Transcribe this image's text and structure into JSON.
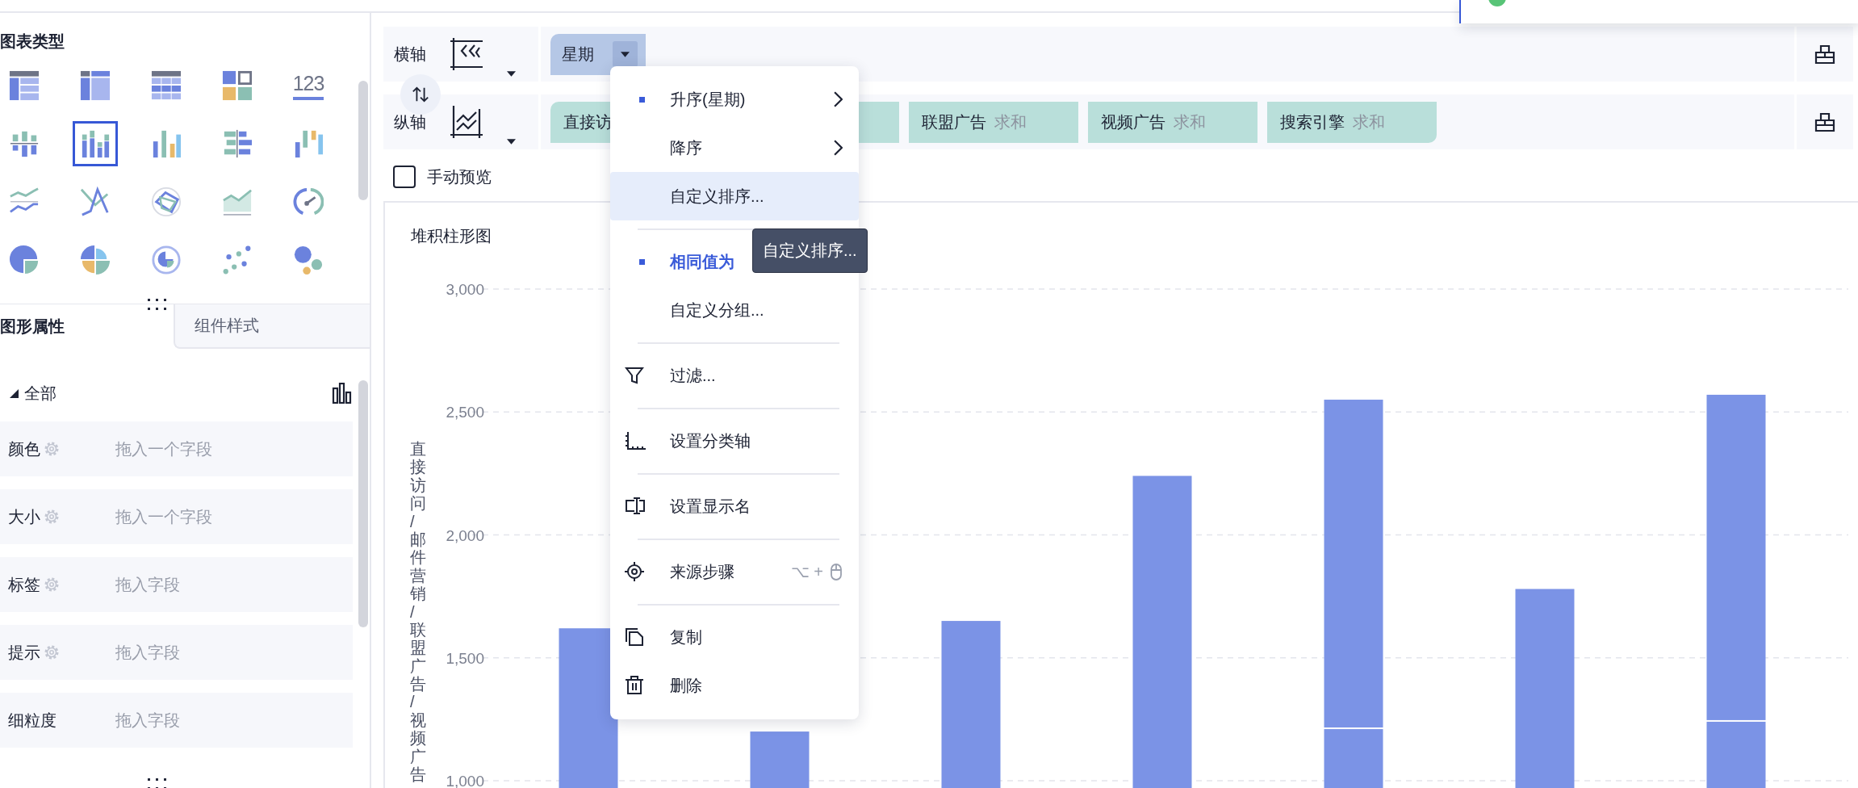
{
  "chart_panel": {
    "title": "图表类型",
    "chart_types": [
      {
        "selected": false
      },
      {
        "selected": false
      },
      {
        "selected": false
      },
      {
        "selected": false
      },
      {
        "label": "123",
        "selected": false
      },
      {
        "selected": false
      },
      {
        "selected": true
      },
      {
        "selected": false
      },
      {
        "selected": false
      },
      {
        "selected": false
      },
      {
        "selected": false
      },
      {
        "selected": false
      },
      {
        "selected": false
      },
      {
        "selected": false
      },
      {
        "selected": false
      },
      {
        "selected": false
      },
      {
        "selected": false
      },
      {
        "selected": false
      },
      {
        "selected": false
      },
      {
        "selected": false
      }
    ]
  },
  "tabs": [
    {
      "label": "图形属性",
      "selected": true
    },
    {
      "label": "组件样式",
      "selected": false
    }
  ],
  "marks": {
    "section": "全部",
    "expanded": true,
    "fields": [
      {
        "label": "颜色",
        "has_settings": true,
        "hint": "拖入一个字段"
      },
      {
        "label": "大小",
        "has_settings": true,
        "hint": "拖入一个字段"
      },
      {
        "label": "标签",
        "has_settings": true,
        "hint": "拖入字段"
      },
      {
        "label": "提示",
        "has_settings": true,
        "hint": "拖入字段"
      },
      {
        "label": "细粒度",
        "has_settings": false,
        "hint": "拖入字段"
      }
    ]
  },
  "shelves": [
    {
      "label": "横轴",
      "kind": "x",
      "pills": [
        {
          "label": "星期",
          "kind": "dimension",
          "has_dropdown": true
        }
      ]
    },
    {
      "label": "纵轴",
      "kind": "y",
      "pills": [
        {
          "label": "直接访",
          "kind": "measure"
        },
        {
          "kind": "measure"
        },
        {
          "label": "联盟广告",
          "aggregate": "求和",
          "kind": "measure"
        },
        {
          "label": "视频广告",
          "aggregate": "求和",
          "kind": "measure"
        },
        {
          "label": "搜索引擎",
          "aggregate": "求和",
          "kind": "measure"
        }
      ]
    }
  ],
  "manual_preview": {
    "label": "手动预览",
    "checked": false
  },
  "chart": {
    "title": "堆积柱形图",
    "chart_data": {
      "type": "bar",
      "stacked": true,
      "grid": true,
      "ylim": [
        1000,
        3000
      ],
      "ylabel": "直接访问/邮件营销/联盟广告/视频广告",
      "yticks": [
        {
          "value": 1000,
          "label": "1,000"
        },
        {
          "value": 1500,
          "label": "1,500"
        },
        {
          "value": 2000,
          "label": "2,000"
        },
        {
          "value": 2500,
          "label": "2,500"
        },
        {
          "value": 3000,
          "label": "3,000"
        }
      ],
      "series": [
        {
          "color": "#7b93e6",
          "values": [
            1620,
            1200,
            1650,
            2240,
            1210,
            1780,
            1240
          ]
        },
        {
          "color": "#7b93e6",
          "values": [
            null,
            null,
            null,
            null,
            1340,
            null,
            1330
          ]
        }
      ]
    }
  },
  "menu": {
    "groups": [
      [
        {
          "label": "升序(星期)",
          "kind": "sort",
          "marked": true,
          "active": false,
          "submenu": true,
          "highlighted": false
        },
        {
          "label": "降序",
          "kind": "sort",
          "marked": false,
          "active": false,
          "submenu": true,
          "highlighted": false
        },
        {
          "label": "自定义排序...",
          "kind": "sort",
          "marked": false,
          "active": false,
          "submenu": false,
          "highlighted": true
        }
      ],
      [
        {
          "label": "相同值为",
          "kind": "sort",
          "marked": true,
          "active": true,
          "submenu": false,
          "highlighted": false
        },
        {
          "label": "自定义分组...",
          "kind": "sort",
          "marked": false,
          "active": false,
          "submenu": false,
          "highlighted": false
        }
      ],
      [
        {
          "label": "过滤...",
          "kind": "filter",
          "marked": false,
          "active": false,
          "submenu": false,
          "highlighted": false
        }
      ],
      [
        {
          "label": "设置分类轴",
          "kind": "axis",
          "marked": false,
          "active": false,
          "submenu": false,
          "highlighted": false
        }
      ],
      [
        {
          "label": "设置显示名",
          "kind": "rename",
          "marked": false,
          "active": false,
          "submenu": false,
          "highlighted": false
        }
      ],
      [
        {
          "label": "来源步骤",
          "kind": "source",
          "shortcut": "⌥ +",
          "marked": false,
          "active": false,
          "submenu": false,
          "highlighted": false
        }
      ],
      [
        {
          "label": "复制",
          "kind": "copy",
          "marked": false,
          "active": false,
          "submenu": false,
          "highlighted": false
        },
        {
          "label": "删除",
          "kind": "delete",
          "marked": false,
          "active": false,
          "submenu": false,
          "highlighted": false
        }
      ]
    ]
  },
  "tooltip": "自定义排序..."
}
